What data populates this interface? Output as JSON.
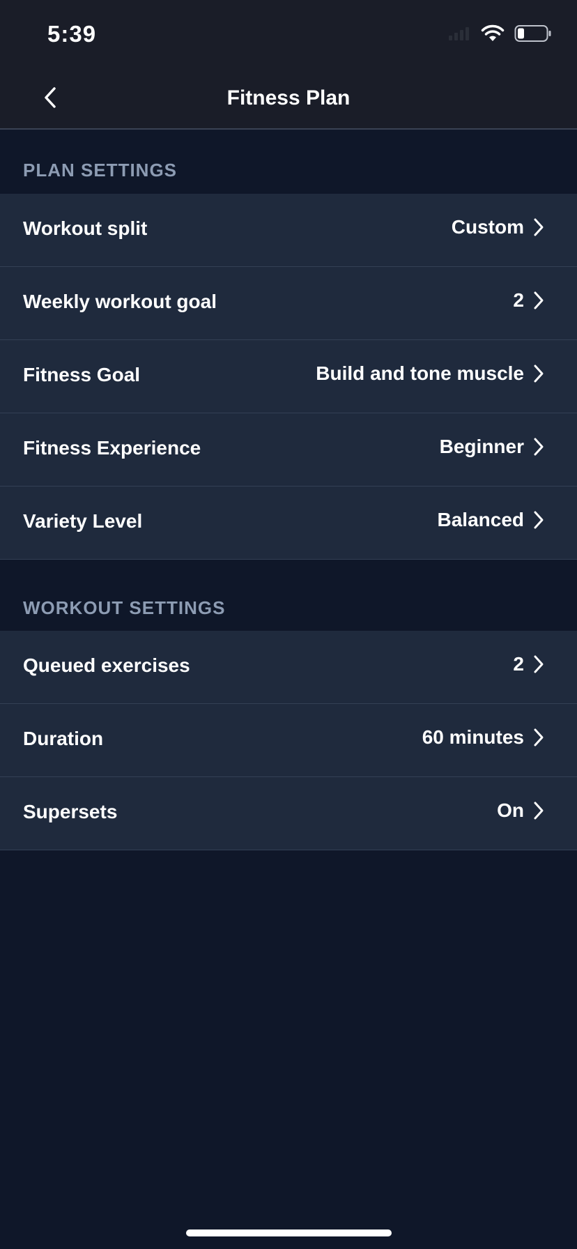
{
  "status_bar": {
    "time": "5:39"
  },
  "nav": {
    "title": "Fitness Plan",
    "back_icon": "chevron-left-icon"
  },
  "plan_settings": {
    "header": "PLAN SETTINGS",
    "rows": [
      {
        "label": "Workout split",
        "value": "Custom"
      },
      {
        "label": "Weekly workout goal",
        "value": "2"
      },
      {
        "label": "Fitness Goal",
        "value": "Build and tone muscle"
      },
      {
        "label": "Fitness Experience",
        "value": "Beginner"
      },
      {
        "label": "Variety Level",
        "value": "Balanced"
      }
    ]
  },
  "workout_settings": {
    "header": "WORKOUT SETTINGS",
    "rows": [
      {
        "label": "Queued exercises",
        "value": "2"
      },
      {
        "label": "Duration",
        "value": "60 minutes"
      },
      {
        "label": "Supersets",
        "value": "On"
      }
    ]
  },
  "colors": {
    "background": "#0f1729",
    "bar_background": "#1a1d28",
    "row_background": "#1f2a3d",
    "section_header_text": "#8d9cb3"
  }
}
